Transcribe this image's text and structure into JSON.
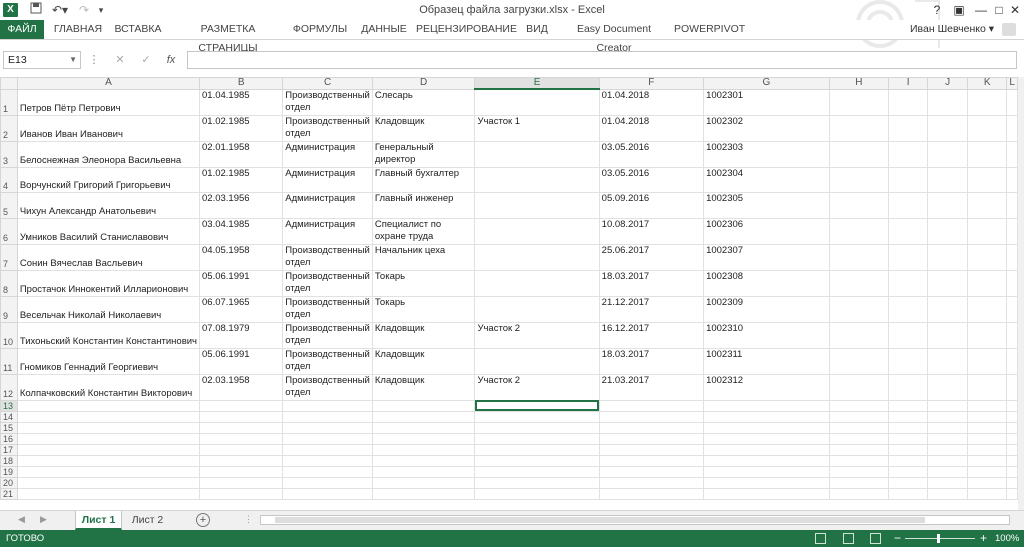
{
  "window": {
    "title": "Образец файла загрузки.xlsx - Excel",
    "app_icon": "X",
    "help": "?",
    "minimize": "—",
    "restore": "□",
    "close": "✕"
  },
  "ribbon": {
    "tabs": [
      "ФАЙЛ",
      "ГЛАВНАЯ",
      "ВСТАВКА",
      "РАЗМЕТКА СТРАНИЦЫ",
      "ФОРМУЛЫ",
      "ДАННЫЕ",
      "РЕЦЕНЗИРОВАНИЕ",
      "ВИД",
      "Easy Document Creator",
      "POWERPIVOT"
    ],
    "user": "Иван Шевченко"
  },
  "formula_bar": {
    "name_box": "E13",
    "fx": "fx",
    "formula": ""
  },
  "grid": {
    "columns": [
      "A",
      "B",
      "C",
      "D",
      "E",
      "F",
      "G",
      "H",
      "I",
      "J",
      "K",
      "L"
    ],
    "rows": [
      {
        "num": "1",
        "a": "Петров Пётр Петрович",
        "b": "01.04.1985",
        "c": "Производственный отдел",
        "d": "Слесарь",
        "e": "",
        "f": "01.04.2018",
        "g": "1002301"
      },
      {
        "num": "2",
        "a": "Иванов Иван Иванович",
        "b": "01.02.1985",
        "c": "Производственный отдел",
        "d": "Кладовщик",
        "e": "Участок 1",
        "f": "01.04.2018",
        "g": "1002302"
      },
      {
        "num": "3",
        "a": "Белоснежная Элеонора Васильевна",
        "b": "02.01.1958",
        "c": "Администрация",
        "d": "Генеральный директор",
        "e": "",
        "f": "03.05.2016",
        "g": "1002303"
      },
      {
        "num": "4",
        "a": "Ворчунский Григорий Григорьевич",
        "b": "01.02.1985",
        "c": "Администрация",
        "d": "Главный бухгалтер",
        "e": "",
        "f": "03.05.2016",
        "g": "1002304"
      },
      {
        "num": "5",
        "a": "Чихун Александр Анатольевич",
        "b": "02.03.1956",
        "c": "Администрация",
        "d": "Главный инженер",
        "e": "",
        "f": "05.09.2016",
        "g": "1002305"
      },
      {
        "num": "6",
        "a": "Умников Василий Станиславович",
        "b": "03.04.1985",
        "c": "Администрация",
        "d": "Специалист по охране труда",
        "e": "",
        "f": "10.08.2017",
        "g": "1002306"
      },
      {
        "num": "7",
        "a": "Сонин Вячеслав Васльевич",
        "b": "04.05.1958",
        "c": "Производственный отдел",
        "d": "Начальник цеха",
        "e": "",
        "f": "25.06.2017",
        "g": "1002307"
      },
      {
        "num": "8",
        "a": "Простачок Иннокентий Илларионович",
        "b": "05.06.1991",
        "c": "Производственный отдел",
        "d": "Токарь",
        "e": "",
        "f": "18.03.2017",
        "g": "1002308"
      },
      {
        "num": "9",
        "a": "Весельчак Николай Николаевич",
        "b": "06.07.1965",
        "c": "Производственный отдел",
        "d": "Токарь",
        "e": "",
        "f": "21.12.2017",
        "g": "1002309"
      },
      {
        "num": "10",
        "a": "Тихоньский Константин Константинович",
        "b": "07.08.1979",
        "c": "Производственный отдел",
        "d": "Кладовщик",
        "e": "Участок 2",
        "f": "16.12.2017",
        "g": "1002310"
      },
      {
        "num": "11",
        "a": "Гномиков Геннадий Георгиевич",
        "b": "05.06.1991",
        "c": "Производственный отдел",
        "d": "Кладовщик",
        "e": "",
        "f": "18.03.2017",
        "g": "1002311"
      },
      {
        "num": "12",
        "a": "Колпачковский Константин Викторович",
        "b": "02.03.1958",
        "c": "Производственный отдел",
        "d": "Кладовщик",
        "e": "Участок 2",
        "f": "21.03.2017",
        "g": "1002312"
      }
    ],
    "empty_rows": [
      "13",
      "14",
      "15",
      "16",
      "17",
      "18",
      "19",
      "20",
      "21"
    ],
    "active_cell": "E13"
  },
  "sheets": {
    "tabs": [
      "Лист 1",
      "Лист 2"
    ],
    "active": "Лист 1",
    "add": "+"
  },
  "status": {
    "ready": "ГОТОВО",
    "zoom": "100%"
  },
  "colors": {
    "accent": "#217346"
  }
}
